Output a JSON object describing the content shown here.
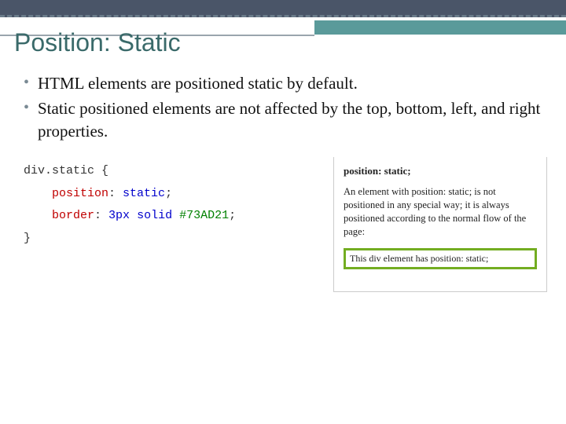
{
  "title": "Position: Static",
  "bullets": [
    "HTML elements are positioned static by default.",
    "Static positioned elements are not affected by the top, bottom, left, and right properties."
  ],
  "code": {
    "selector": "div.static",
    "open": " {",
    "line1_prop": "position",
    "line1_sep": ": ",
    "line1_val": "static",
    "line1_end": ";",
    "line2_prop": "border",
    "line2_sep": ": ",
    "line2_val_a": "3px",
    "line2_val_b": " solid ",
    "line2_val_c": "#73AD21",
    "line2_end": ";",
    "close": "}"
  },
  "example": {
    "heading": "position: static;",
    "paragraph": "An element with position: static; is not positioned in any special way; it is always positioned according to the normal flow of the page:",
    "box_text": "This div element has position: static;"
  }
}
